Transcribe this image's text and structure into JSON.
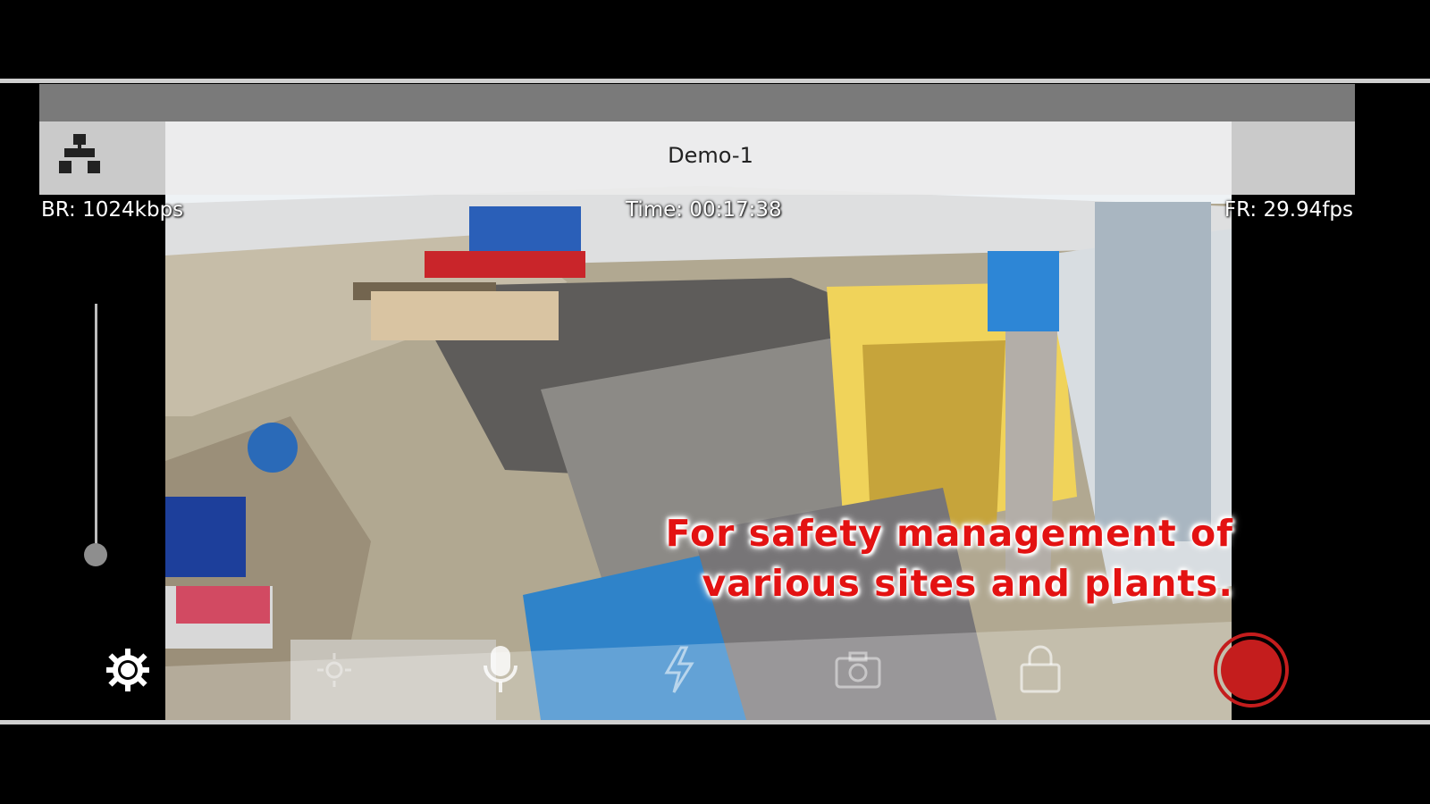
{
  "header": {
    "device_name": "Demo-1"
  },
  "stats": {
    "bitrate": "BR:  1024kbps",
    "time": "Time: 00:17:38",
    "framerate": "FR:  29.94fps"
  },
  "caption": {
    "line1": "For safety management of",
    "line2": "various sites and plants."
  },
  "zoom": {
    "level": 0
  },
  "toolbar": {
    "icons": [
      "settings-icon",
      "brightness-icon",
      "microphone-icon",
      "flash-icon",
      "camera-switch-icon",
      "lock-icon",
      "record-button"
    ]
  },
  "colors": {
    "record": "#c41d1d",
    "caption": "#e31212",
    "top_bar": "#7a7a7a"
  }
}
